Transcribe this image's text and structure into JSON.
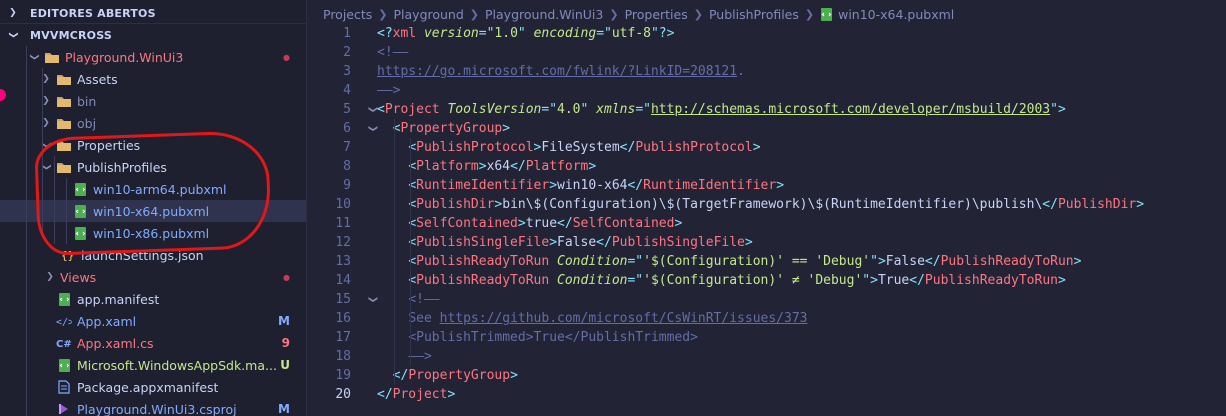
{
  "sidebar": {
    "open_editors": "EDITORES ABERTOS",
    "project": "MVVMCROSS",
    "items": [
      {
        "label": "Playground.WinUi3",
        "color": "#ff757f",
        "badge": "●",
        "badge_color": "#c53b53",
        "arrow": "down",
        "icon": "folder-icon"
      },
      {
        "label": "Assets",
        "color": "#c8d3f5",
        "badge": "",
        "badge_color": "",
        "arrow": "right",
        "icon": "folder-icon"
      },
      {
        "label": "bin",
        "color": "#828bb8",
        "badge": "",
        "badge_color": "",
        "arrow": "right",
        "icon": "folder-icon"
      },
      {
        "label": "obj",
        "color": "#828bb8",
        "badge": "",
        "badge_color": "",
        "arrow": "right",
        "icon": "folder-icon"
      },
      {
        "label": "Properties",
        "color": "#c8d3f5",
        "badge": "",
        "badge_color": "",
        "arrow": "down",
        "icon": "folder-icon"
      },
      {
        "label": "PublishProfiles",
        "color": "#c8d3f5",
        "badge": "",
        "badge_color": "",
        "arrow": "down",
        "icon": "folder-icon"
      },
      {
        "label": "win10-arm64.pubxml",
        "color": "#82aaff",
        "badge": "",
        "badge_color": "",
        "arrow": "",
        "icon": "xml-file-icon"
      },
      {
        "label": "win10-x64.pubxml",
        "color": "#82aaff",
        "badge": "",
        "badge_color": "",
        "arrow": "",
        "icon": "xml-file-icon"
      },
      {
        "label": "win10-x86.pubxml",
        "color": "#82aaff",
        "badge": "",
        "badge_color": "",
        "arrow": "",
        "icon": "xml-file-icon"
      },
      {
        "label": "launchSettings.json",
        "color": "#c8d3f5",
        "badge": "",
        "badge_color": "",
        "arrow": "",
        "icon": "json-file-icon"
      },
      {
        "label": "Views",
        "color": "#ff757f",
        "badge": "●",
        "badge_color": "#c53b53",
        "arrow": "right",
        "icon": "folder-icon"
      },
      {
        "label": "app.manifest",
        "color": "#c8d3f5",
        "badge": "",
        "badge_color": "",
        "arrow": "",
        "icon": "xml-file-icon"
      },
      {
        "label": "App.xaml",
        "color": "#82aaff",
        "badge": "M",
        "badge_color": "#82aaff",
        "arrow": "",
        "icon": "xaml-file-icon"
      },
      {
        "label": "App.xaml.cs",
        "color": "#ff757f",
        "badge": "9",
        "badge_color": "#ff757f",
        "arrow": "",
        "icon": "csharp-file-icon"
      },
      {
        "label": "Microsoft.WindowsAppSdk.ma...",
        "color": "#c3e88d",
        "badge": "U",
        "badge_color": "#c3e88d",
        "arrow": "",
        "icon": "xml-file-icon"
      },
      {
        "label": "Package.appxmanifest",
        "color": "#c8d3f5",
        "badge": "",
        "badge_color": "",
        "arrow": "",
        "icon": "file-icon"
      },
      {
        "label": "Playground.WinUi3.csproj",
        "color": "#82aaff",
        "badge": "M",
        "badge_color": "#82aaff",
        "arrow": "",
        "icon": "csproj-file-icon"
      }
    ]
  },
  "breadcrumb": [
    "Projects",
    "Playground",
    "Playground.WinUi3",
    "Properties",
    "PublishProfiles",
    "win10-x64.pubxml"
  ],
  "code": {
    "line_numbers": [
      "1",
      "2",
      "3",
      "4",
      "5",
      "6",
      "7",
      "8",
      "9",
      "10",
      "11",
      "12",
      "13",
      "14",
      "15",
      "16",
      "17",
      "18",
      "19",
      "20"
    ],
    "lines": [
      [
        [
          "c-pun",
          "<?"
        ],
        [
          "c-xml",
          "xml"
        ],
        [
          "c-txt",
          " "
        ],
        [
          "c-attr",
          "version"
        ],
        [
          "c-pun",
          "=\""
        ],
        [
          "c-str",
          "1.0"
        ],
        [
          "c-pun",
          "\""
        ],
        [
          "c-txt",
          " "
        ],
        [
          "c-attr",
          "encoding"
        ],
        [
          "c-pun",
          "=\""
        ],
        [
          "c-str",
          "utf-8"
        ],
        [
          "c-pun",
          "\"?>"
        ]
      ],
      [
        [
          "c-com",
          "<!——"
        ]
      ],
      [
        [
          "c-comu",
          "https://go.microsoft.com/fwlink/?LinkID=208121"
        ],
        [
          "c-com",
          "."
        ]
      ],
      [
        [
          "c-com",
          "——>"
        ]
      ],
      [
        [
          "c-pun",
          "<"
        ],
        [
          "c-tag",
          "Project"
        ],
        [
          "c-txt",
          " "
        ],
        [
          "c-attr",
          "ToolsVersion"
        ],
        [
          "c-pun",
          "=\""
        ],
        [
          "c-str",
          "4.0"
        ],
        [
          "c-pun",
          "\""
        ],
        [
          "c-txt",
          " "
        ],
        [
          "c-attr",
          "xmlns"
        ],
        [
          "c-pun",
          "=\""
        ],
        [
          "c-url",
          "http://schemas.microsoft.com/developer/msbuild/2003"
        ],
        [
          "c-pun",
          "\">"
        ]
      ],
      [
        [
          "c-txt",
          "  "
        ],
        [
          "c-pun",
          "<"
        ],
        [
          "c-tag",
          "PropertyGroup"
        ],
        [
          "c-pun",
          ">"
        ]
      ],
      [
        [
          "c-txt",
          "    "
        ],
        [
          "c-pun",
          "<"
        ],
        [
          "c-tag",
          "PublishProtocol"
        ],
        [
          "c-pun",
          ">"
        ],
        [
          "c-txt",
          "FileSystem"
        ],
        [
          "c-pun",
          "</"
        ],
        [
          "c-tag",
          "PublishProtocol"
        ],
        [
          "c-pun",
          ">"
        ]
      ],
      [
        [
          "c-txt",
          "    "
        ],
        [
          "c-pun",
          "<"
        ],
        [
          "c-tag",
          "Platform"
        ],
        [
          "c-pun",
          ">"
        ],
        [
          "c-txt",
          "x64"
        ],
        [
          "c-pun",
          "</"
        ],
        [
          "c-tag",
          "Platform"
        ],
        [
          "c-pun",
          ">"
        ]
      ],
      [
        [
          "c-txt",
          "    "
        ],
        [
          "c-pun",
          "<"
        ],
        [
          "c-tag",
          "RuntimeIdentifier"
        ],
        [
          "c-pun",
          ">"
        ],
        [
          "c-txt",
          "win10-x64"
        ],
        [
          "c-pun",
          "</"
        ],
        [
          "c-tag",
          "RuntimeIdentifier"
        ],
        [
          "c-pun",
          ">"
        ]
      ],
      [
        [
          "c-txt",
          "    "
        ],
        [
          "c-pun",
          "<"
        ],
        [
          "c-tag",
          "PublishDir"
        ],
        [
          "c-pun",
          ">"
        ],
        [
          "c-txt",
          "bin\\$(Configuration)\\$(TargetFramework)\\$(RuntimeIdentifier)\\publish\\"
        ],
        [
          "c-pun",
          "</"
        ],
        [
          "c-tag",
          "PublishDir"
        ],
        [
          "c-pun",
          ">"
        ]
      ],
      [
        [
          "c-txt",
          "    "
        ],
        [
          "c-pun",
          "<"
        ],
        [
          "c-tag",
          "SelfContained"
        ],
        [
          "c-pun",
          ">"
        ],
        [
          "c-txt",
          "true"
        ],
        [
          "c-pun",
          "</"
        ],
        [
          "c-tag",
          "SelfContained"
        ],
        [
          "c-pun",
          ">"
        ]
      ],
      [
        [
          "c-txt",
          "    "
        ],
        [
          "c-pun",
          "<"
        ],
        [
          "c-tag",
          "PublishSingleFile"
        ],
        [
          "c-pun",
          ">"
        ],
        [
          "c-txt",
          "False"
        ],
        [
          "c-pun",
          "</"
        ],
        [
          "c-tag",
          "PublishSingleFile"
        ],
        [
          "c-pun",
          ">"
        ]
      ],
      [
        [
          "c-txt",
          "    "
        ],
        [
          "c-pun",
          "<"
        ],
        [
          "c-tag",
          "PublishReadyToRun"
        ],
        [
          "c-txt",
          " "
        ],
        [
          "c-attr",
          "Condition"
        ],
        [
          "c-pun",
          "=\""
        ],
        [
          "c-str",
          "'$(Configuration)' == 'Debug'"
        ],
        [
          "c-pun",
          "\">"
        ],
        [
          "c-txt",
          "False"
        ],
        [
          "c-pun",
          "</"
        ],
        [
          "c-tag",
          "PublishReadyToRun"
        ],
        [
          "c-pun",
          ">"
        ]
      ],
      [
        [
          "c-txt",
          "    "
        ],
        [
          "c-pun",
          "<"
        ],
        [
          "c-tag",
          "PublishReadyToRun"
        ],
        [
          "c-txt",
          " "
        ],
        [
          "c-attr",
          "Condition"
        ],
        [
          "c-pun",
          "=\""
        ],
        [
          "c-str",
          "'$(Configuration)' ≠ 'Debug'"
        ],
        [
          "c-pun",
          "\">"
        ],
        [
          "c-txt",
          "True"
        ],
        [
          "c-pun",
          "</"
        ],
        [
          "c-tag",
          "PublishReadyToRun"
        ],
        [
          "c-pun",
          ">"
        ]
      ],
      [
        [
          "c-txt",
          "    "
        ],
        [
          "c-com",
          "<!——"
        ]
      ],
      [
        [
          "c-txt",
          "    "
        ],
        [
          "c-com",
          "See "
        ],
        [
          "c-comu",
          "https://github.com/microsoft/CsWinRT/issues/373"
        ]
      ],
      [
        [
          "c-txt",
          "    "
        ],
        [
          "c-com",
          "<PublishTrimmed>True</PublishTrimmed>"
        ]
      ],
      [
        [
          "c-txt",
          "    "
        ],
        [
          "c-com",
          "——>"
        ]
      ],
      [
        [
          "c-txt",
          "  "
        ],
        [
          "c-pun",
          "</"
        ],
        [
          "c-tag",
          "PropertyGroup"
        ],
        [
          "c-pun",
          ">"
        ]
      ],
      [
        [
          "c-pun",
          "</"
        ],
        [
          "c-tag",
          "Project"
        ],
        [
          "c-pun",
          ">"
        ]
      ]
    ],
    "folds": {
      "5": "⌄",
      "6": "⌄",
      "15": "⌄"
    }
  }
}
